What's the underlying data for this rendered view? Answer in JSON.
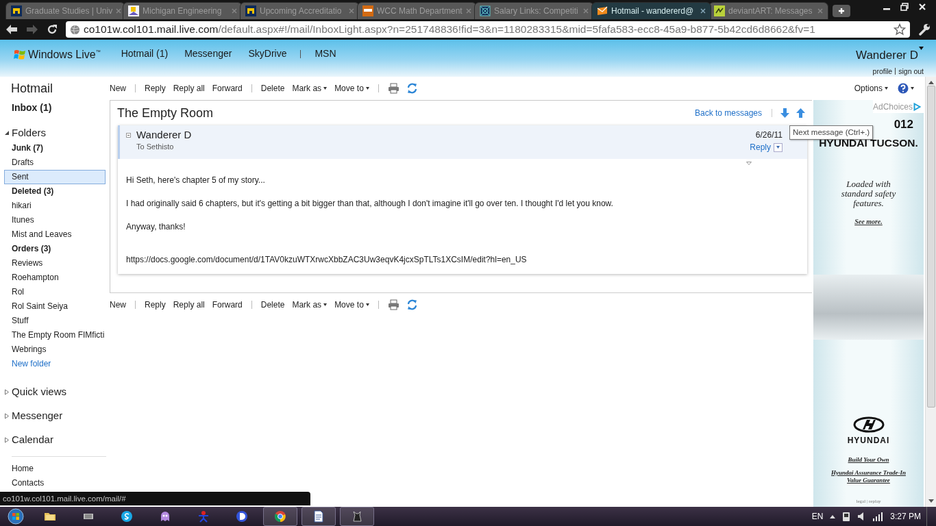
{
  "browser": {
    "tabs": [
      {
        "title": "Graduate Studies | Univ",
        "kind": "block-m",
        "selected": false
      },
      {
        "title": "Michigan Engineering",
        "kind": "engineering",
        "selected": false
      },
      {
        "title": "Upcoming Accreditatio",
        "kind": "block-m",
        "selected": false
      },
      {
        "title": "WCC Math Department",
        "kind": "wcc",
        "selected": false
      },
      {
        "title": "Salary Links: Competiti",
        "kind": "salary",
        "selected": false
      },
      {
        "title": "Hotmail - wandererd@",
        "kind": "mail",
        "selected": true
      },
      {
        "title": "deviantART: Messages",
        "kind": "deviantart",
        "selected": false
      }
    ],
    "address": {
      "host": "co101w.col101.mail.live.com",
      "path": "/default.aspx#!/mail/InboxLight.aspx?n=251748836!fid=3&n=1180283315&mid=5fafa583-ecc8-45a9-b877-5b42cd6d8662&fv=1"
    }
  },
  "header": {
    "brand": "Windows Live$^{™}$",
    "nav": [
      [
        "Hotmail (1)",
        "Messenger",
        "SkyDrive"
      ],
      [
        "MSN"
      ]
    ],
    "user": {
      "name": "Wanderer D",
      "links": [
        "profile",
        "sign out"
      ]
    }
  },
  "sidebar": {
    "title": "Hotmail",
    "inbox": "Inbox (1)",
    "folders": {
      "label": "Folders",
      "expanded": true,
      "items": [
        {
          "label": "Junk (7)",
          "unread": true,
          "selected": false
        },
        {
          "label": "Drafts",
          "unread": false,
          "selected": false
        },
        {
          "label": "Sent",
          "unread": false,
          "selected": true
        },
        {
          "label": "Deleted (3)",
          "unread": true,
          "selected": false
        },
        {
          "label": "hikari",
          "unread": false,
          "selected": false
        },
        {
          "label": "Itunes",
          "unread": false,
          "selected": false
        },
        {
          "label": "Mist and Leaves",
          "unread": false,
          "selected": false
        },
        {
          "label": "Orders (3)",
          "unread": true,
          "selected": false
        },
        {
          "label": "Reviews",
          "unread": false,
          "selected": false
        },
        {
          "label": "Roehampton",
          "unread": false,
          "selected": false
        },
        {
          "label": "Rol",
          "unread": false,
          "selected": false
        },
        {
          "label": "Rol Saint Seiya",
          "unread": false,
          "selected": false
        },
        {
          "label": "Stuff",
          "unread": false,
          "selected": false
        },
        {
          "label": "The Empty Room FIMficti",
          "unread": false,
          "selected": false
        },
        {
          "label": "Webrings",
          "unread": false,
          "selected": false
        }
      ],
      "new_folder": "New folder"
    },
    "sections": [
      {
        "label": "Quick views",
        "expanded": false
      },
      {
        "label": "Messenger",
        "expanded": false
      },
      {
        "label": "Calendar",
        "expanded": false
      }
    ],
    "links": [
      "Home",
      "Contacts"
    ]
  },
  "toolbar_top": [
    [
      {
        "kind": "action",
        "label": "New"
      }
    ],
    [
      {
        "kind": "action",
        "label": "Reply"
      },
      {
        "kind": "action",
        "label": "Reply all"
      },
      {
        "kind": "action",
        "label": "Forward"
      }
    ],
    [
      {
        "kind": "action",
        "label": "Delete"
      },
      {
        "kind": "menu",
        "label": "Mark as"
      },
      {
        "kind": "menu",
        "label": "Move to"
      }
    ],
    [
      {
        "kind": "print"
      },
      {
        "kind": "refresh"
      }
    ]
  ],
  "options": {
    "label": "Options"
  },
  "message": {
    "subject": "The Empty Room",
    "back_link": "Back to messages",
    "tooltip": "Next message (Ctrl+.)",
    "sender": "Wanderer D",
    "to": "To Sethisto",
    "date": "6/26/11",
    "reply": "Reply",
    "body": [
      "Hi Seth, here's chapter 5 of my story...",
      "I had originally said 6 chapters, but it's getting a bit bigger than that, although I don't imagine it'll go over ten. I thought I'd let you know.",
      "Anyway, thanks!"
    ],
    "link": "https://docs.google.com/document/d/1TAV0kzuWTXrwcXbbZAC3Uw3eqvK4jcxSpTLTs1XCsIM/edit?hl=en_US"
  },
  "toolbar_bottom": [
    [
      {
        "kind": "action",
        "label": "New"
      }
    ],
    [
      {
        "kind": "action",
        "label": "Reply"
      },
      {
        "kind": "action",
        "label": "Reply all"
      },
      {
        "kind": "action",
        "label": "Forward"
      }
    ],
    [
      {
        "kind": "action",
        "label": "Delete"
      },
      {
        "kind": "menu",
        "label": "Mark as"
      },
      {
        "kind": "menu",
        "label": "Move to"
      }
    ],
    [
      {
        "kind": "print"
      },
      {
        "kind": "refresh"
      }
    ]
  ],
  "ad": {
    "choices": "AdChoices",
    "headline": [
      "012",
      "HYUNDAI TUCSON."
    ],
    "tagline": "Loaded with standard safety features.",
    "see_more": "See more.",
    "wordmark": "HYUNDAI",
    "links": [
      "Build Your Own",
      "Hyundai Assurance Trade-In Value Guarantee"
    ],
    "legal": "legal | replay"
  },
  "status_bubble": "co101w.col101.mail.live.com/mail/#",
  "taskbar": {
    "pinned": [
      {
        "kind": "folder",
        "open": false
      },
      {
        "kind": "media",
        "open": false
      },
      {
        "kind": "skype",
        "open": false
      },
      {
        "kind": "ghost",
        "open": false
      },
      {
        "kind": "figure",
        "open": false
      },
      {
        "kind": "d-app",
        "open": false
      },
      {
        "kind": "chrome",
        "open": true
      },
      {
        "kind": "document",
        "open": true
      },
      {
        "kind": "cat",
        "open": true
      }
    ],
    "language": "EN",
    "clock": "3:27 PM"
  }
}
